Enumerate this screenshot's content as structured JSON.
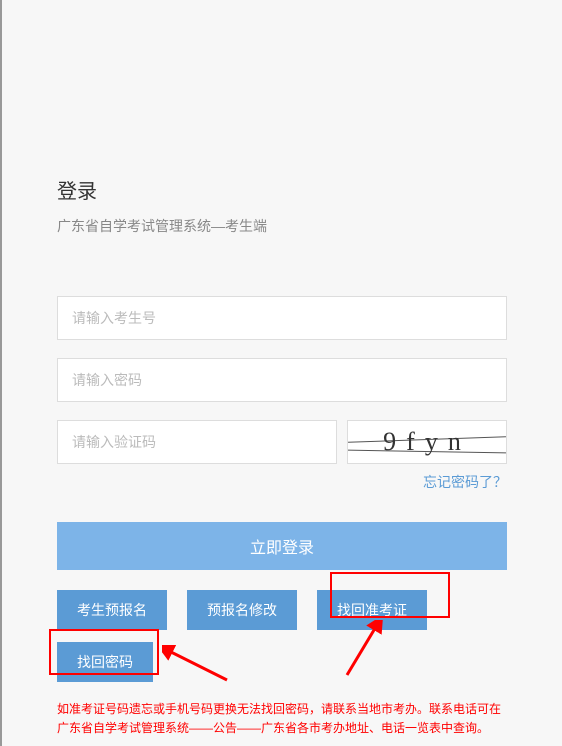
{
  "title": "登录",
  "subtitle": "广东省自学考试管理系统—考生端",
  "inputs": {
    "exam_id_placeholder": "请输入考生号",
    "password_placeholder": "请输入密码",
    "captcha_placeholder": "请输入验证码"
  },
  "captcha_text": "9fyn",
  "forgot_link": "忘记密码了？",
  "login_button": "立即登录",
  "buttons": {
    "pre_register": "考生预报名",
    "modify_register": "预报名修改",
    "find_exam_cert": "找回准考证",
    "find_password": "找回密码"
  },
  "note": "如准考证号码遗忘或手机号码更换无法找回密码，请联系当地市考办。联系电话可在广东省自学考试管理系统——公告——广东省各市考办地址、电话一览表中查询。"
}
